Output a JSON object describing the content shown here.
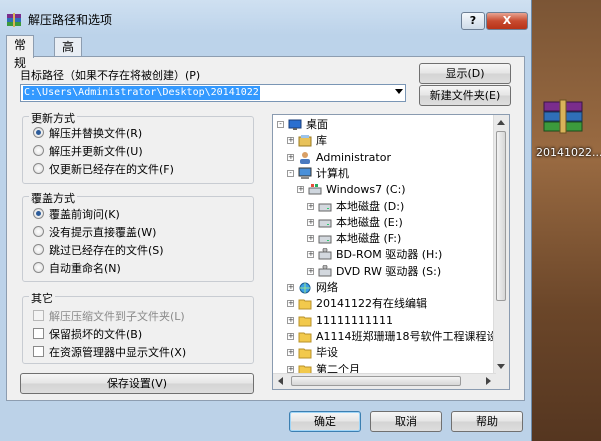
{
  "window": {
    "title": "解压路径和选项"
  },
  "titlebar": {
    "help": "?",
    "close": "X"
  },
  "tabs": [
    {
      "label": "常规"
    },
    {
      "label": "高级"
    }
  ],
  "path": {
    "label": "目标路径（如果不存在将被创建）(P)",
    "value": "C:\\Users\\Administrator\\Desktop\\20141022"
  },
  "buttons": {
    "display": "显示(D)",
    "new_folder": "新建文件夹(E)",
    "save_settings": "保存设置(V)",
    "ok": "确定",
    "cancel": "取消",
    "help": "帮助"
  },
  "update_mode": {
    "title": "更新方式",
    "options": [
      "解压并替换文件(R)",
      "解压并更新文件(U)",
      "仅更新已经存在的文件(F)"
    ],
    "selected": 0
  },
  "overwrite_mode": {
    "title": "覆盖方式",
    "options": [
      "覆盖前询问(K)",
      "没有提示直接覆盖(W)",
      "跳过已经存在的文件(S)",
      "自动重命名(N)"
    ],
    "selected": 0
  },
  "other": {
    "title": "其它",
    "options": [
      {
        "label": "解压压缩文件到子文件夹(L)",
        "checked": false,
        "disabled": true
      },
      {
        "label": "保留损坏的文件(B)",
        "checked": false,
        "disabled": false
      },
      {
        "label": "在资源管理器中显示文件(X)",
        "checked": false,
        "disabled": false
      }
    ]
  },
  "tree": {
    "items": [
      {
        "label": "桌面",
        "icon": "desktop-icon",
        "expander": "-"
      },
      {
        "label": "库",
        "icon": "library-icon",
        "expander": "+"
      },
      {
        "label": "Administrator",
        "icon": "user-icon",
        "expander": "+"
      },
      {
        "label": "计算机",
        "icon": "computer-icon",
        "expander": "-"
      },
      {
        "label": "Windows7 (C:)",
        "icon": "windows-drive-icon",
        "expander": "+"
      },
      {
        "label": "本地磁盘 (D:)",
        "icon": "drive-icon",
        "expander": "+"
      },
      {
        "label": "本地磁盘 (E:)",
        "icon": "drive-icon",
        "expander": "+"
      },
      {
        "label": "本地磁盘 (F:)",
        "icon": "drive-icon",
        "expander": "+"
      },
      {
        "label": "BD-ROM 驱动器 (H:)",
        "icon": "optical-drive-icon",
        "expander": "+"
      },
      {
        "label": "DVD RW 驱动器 (S:)",
        "icon": "optical-drive-icon",
        "expander": "+"
      },
      {
        "label": "网络",
        "icon": "network-icon",
        "expander": "+"
      },
      {
        "label": "20141122有在线编辑",
        "icon": "folder-icon",
        "expander": "+"
      },
      {
        "label": "11111111111",
        "icon": "folder-icon",
        "expander": "+"
      },
      {
        "label": "A1114班郑珊珊18号软件工程课程设",
        "icon": "folder-icon",
        "expander": "+"
      },
      {
        "label": "毕设",
        "icon": "folder-icon",
        "expander": "+"
      },
      {
        "label": "第二个月",
        "icon": "folder-icon",
        "expander": "+"
      }
    ]
  },
  "desktop": {
    "icon_label": "20141022...",
    "icon": "winrar-archive-icon"
  }
}
